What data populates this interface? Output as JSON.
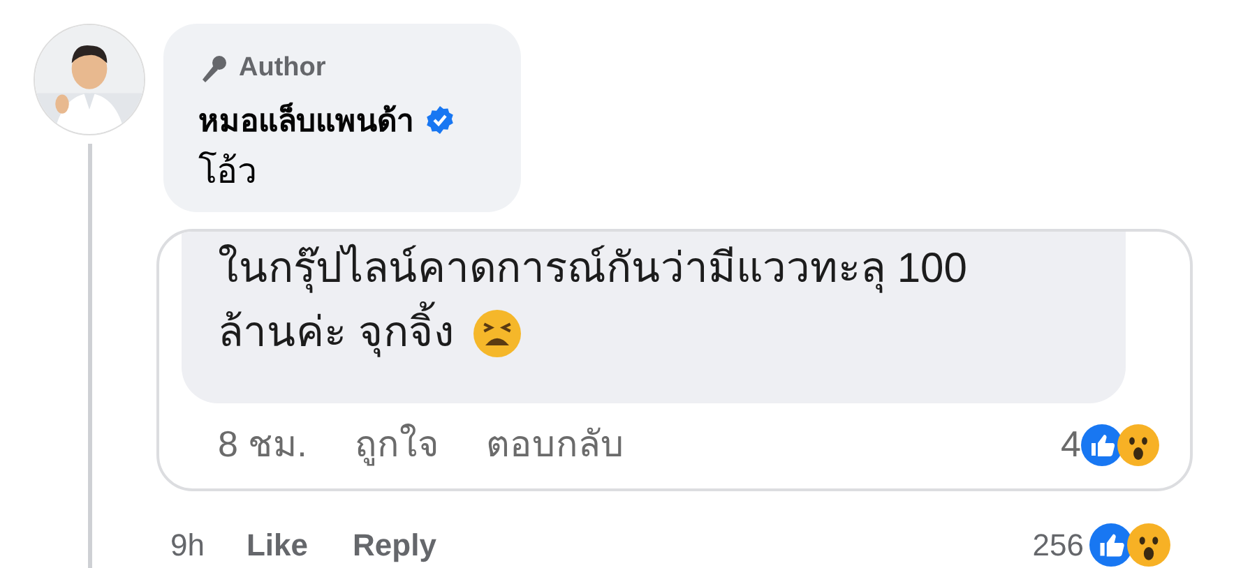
{
  "comment": {
    "badge": "Author",
    "author": "หมอแล็บแพนด้า",
    "verified": true,
    "text": "โอ้ว"
  },
  "shared_screenshot": {
    "text_lines": [
      "ในกรุ๊ปไลน์คาดการณ์กันว่ามีแววทะลุ 100",
      "ล้านค่ะ จุกจิ้ง"
    ],
    "time": "8 ชม.",
    "like": "ถูกใจ",
    "reply": "ตอบกลับ",
    "reaction_count": "4"
  },
  "footer": {
    "time": "9h",
    "like": "Like",
    "reply": "Reply",
    "reaction_count": "256"
  }
}
